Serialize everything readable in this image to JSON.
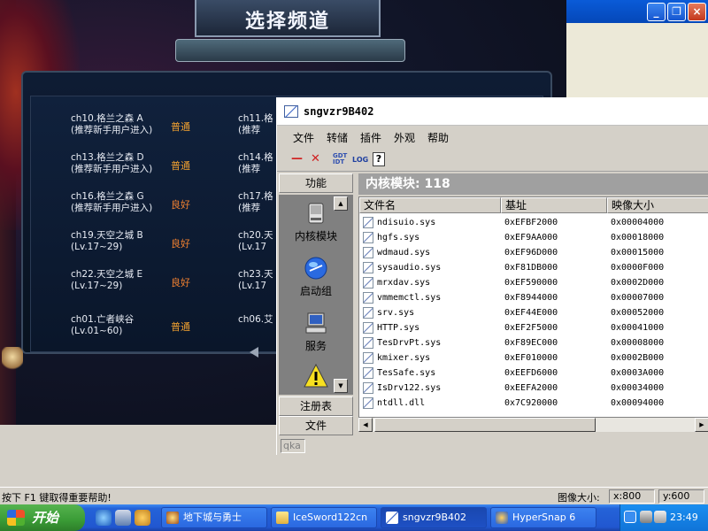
{
  "game": {
    "title": "选择频道",
    "channels": [
      {
        "name": "ch10.格兰之森 A",
        "note": "(推荐新手用户进入)",
        "status": "普通"
      },
      {
        "name": "ch13.格兰之森 D",
        "note": "(推荐新手用户进入)",
        "status": "普通"
      },
      {
        "name": "ch16.格兰之森 G",
        "note": "(推荐新手用户进入)",
        "status": "良好"
      },
      {
        "name": "ch19.天空之城 B",
        "note": "(Lv.17~29)",
        "status": "良好"
      },
      {
        "name": "ch22.天空之城 E",
        "note": "(Lv.17~29)",
        "status": "良好"
      },
      {
        "name": "ch01.亡者峡谷",
        "note": "(Lv.01~60)",
        "status": "普通"
      }
    ],
    "channels_col2": [
      {
        "name": "ch11.格",
        "note": "(推荐"
      },
      {
        "name": "ch14.格",
        "note": "(推荐"
      },
      {
        "name": "ch17.格",
        "note": "(推荐"
      },
      {
        "name": "ch20.天",
        "note": "(Lv.17"
      },
      {
        "name": "ch23.天",
        "note": "(Lv.17"
      },
      {
        "name": "ch06.艾",
        "note": ""
      }
    ]
  },
  "mainwin": {
    "min": "_",
    "max": "❐",
    "close": "×"
  },
  "iceSword": {
    "title": "sngvzr9B402",
    "menu": [
      "文件",
      "转储",
      "插件",
      "外观",
      "帮助"
    ],
    "toolbar": {
      "minus": "—",
      "x": "✕",
      "gdt": "GDT",
      "idt": "IDT",
      "log": "LOG",
      "help": "?"
    },
    "nav": {
      "header": "功能",
      "items": [
        {
          "label": "内核模块",
          "icon": "disk-icon"
        },
        {
          "label": "启动组",
          "icon": "globe-icon"
        },
        {
          "label": "服务",
          "icon": "computer-icon"
        },
        {
          "label": "",
          "icon": "warning-icon"
        }
      ],
      "footer": [
        "注册表",
        "文件"
      ]
    },
    "content": {
      "header": "内核模块: 118",
      "columns": [
        "文件名",
        "基址",
        "映像大小"
      ],
      "rows": [
        [
          "ndisuio.sys",
          "0xEFBF2000",
          "0x00004000"
        ],
        [
          "hgfs.sys",
          "0xEF9AA000",
          "0x00018000"
        ],
        [
          "wdmaud.sys",
          "0xEF96D000",
          "0x00015000"
        ],
        [
          "sysaudio.sys",
          "0xF81DB000",
          "0x0000F000"
        ],
        [
          "mrxdav.sys",
          "0xEF590000",
          "0x0002D000"
        ],
        [
          "vmmemctl.sys",
          "0xF8944000",
          "0x00007000"
        ],
        [
          "srv.sys",
          "0xEF44E000",
          "0x00052000"
        ],
        [
          "HTTP.sys",
          "0xEF2F5000",
          "0x00041000"
        ],
        [
          "TesDrvPt.sys",
          "0xF89EC000",
          "0x00008000"
        ],
        [
          "kmixer.sys",
          "0xEF010000",
          "0x0002B000"
        ],
        [
          "TesSafe.sys",
          "0xEEFD6000",
          "0x0003A000"
        ],
        [
          "IsDrv122.sys",
          "0xEEFA2000",
          "0x00034000"
        ],
        [
          "ntdll.dll",
          "0x7C920000",
          "0x00094000"
        ]
      ]
    },
    "status": "qka"
  },
  "hypersnap": {
    "help": "按下 F1 键取得重要帮助!",
    "size_label": "图像大小:",
    "x": "x:800",
    "y": "y:600"
  },
  "taskbar": {
    "start": "开始",
    "tasks": [
      "地下城与勇士",
      "IceSword122cn",
      "sngvzr9B402",
      "HyperSnap 6"
    ],
    "active_index": 2,
    "clock": "23:49"
  },
  "colors": {
    "status_orange": "#f0a030",
    "taskbar_blue": "#2157d0",
    "start_green": "#3a9b36"
  }
}
